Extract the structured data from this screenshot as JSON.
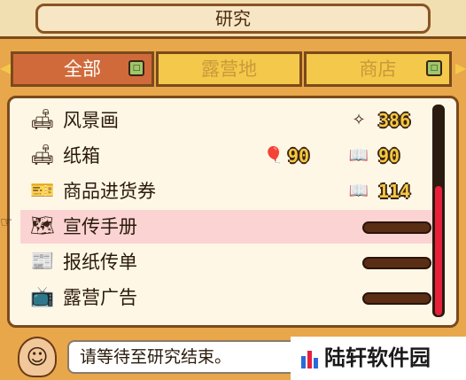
{
  "title": "研究",
  "tabs": [
    {
      "label": "全部",
      "badge": "□"
    },
    {
      "label": "露营地"
    },
    {
      "label": "商店",
      "badge": "□"
    }
  ],
  "rows": [
    {
      "name": "风景画",
      "icon": "sofa-icon",
      "stat_icon": "sparkle-icon",
      "value": "386"
    },
    {
      "name": "纸箱",
      "icon": "sofa-icon",
      "stat_icon_a": "balloon-icon",
      "value_a": "90",
      "stat_icon_b": "book-icon",
      "value_b": "90"
    },
    {
      "name": "商品进货券",
      "icon": "ticket-icon",
      "stat_icon": "book-icon",
      "value": "114"
    },
    {
      "name": "宣传手册",
      "icon": "map-icon",
      "progress": 0
    },
    {
      "name": "报纸传单",
      "icon": "newspaper-icon",
      "progress": 0
    },
    {
      "name": "露营广告",
      "icon": "tv-icon",
      "progress": 0
    }
  ],
  "message": "请等待至研究结束。",
  "watermark": "陆轩软件园",
  "colors": {
    "active_tab": "#d16a3a",
    "inactive_tab": "#f4c84a",
    "selected_row": "#fbd3d3",
    "scroll_thumb": "#e8203a"
  }
}
